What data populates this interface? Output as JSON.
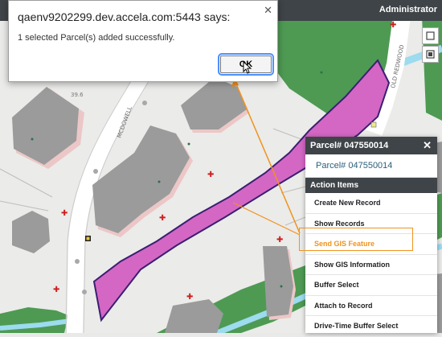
{
  "header": {
    "user_label": "Administrator"
  },
  "dialog": {
    "title": "qaenv9202299.dev.accela.com:5443 says:",
    "message": "1 selected Parcel(s) added successfully.",
    "ok_label": "OK",
    "close_icon": "close-icon"
  },
  "parcel_popup": {
    "title": "Parcel# 047550014",
    "parcel_link": "Parcel# 047550014",
    "section_title": "Action Items",
    "actions": [
      {
        "label": "Create New Record"
      },
      {
        "label": "Show Records"
      },
      {
        "label": "Send GIS Feature",
        "highlighted": true
      },
      {
        "label": "Show GIS Information"
      },
      {
        "label": "Buffer Select"
      },
      {
        "label": "Attach to Record"
      },
      {
        "label": "Drive-Time Buffer Select"
      }
    ]
  },
  "map_labels": {
    "street1": "MCDOWELL",
    "street2": "OLD REDWOOD",
    "lot_number": "39.6"
  },
  "colors": {
    "parcel_fill": "#d467c4",
    "parcel_stroke": "#3b1f72",
    "highlight": "#f0931e",
    "park": "#4e9a53",
    "water": "#9ddbef",
    "building": "#9b9b9b",
    "header": "#3f4448"
  }
}
